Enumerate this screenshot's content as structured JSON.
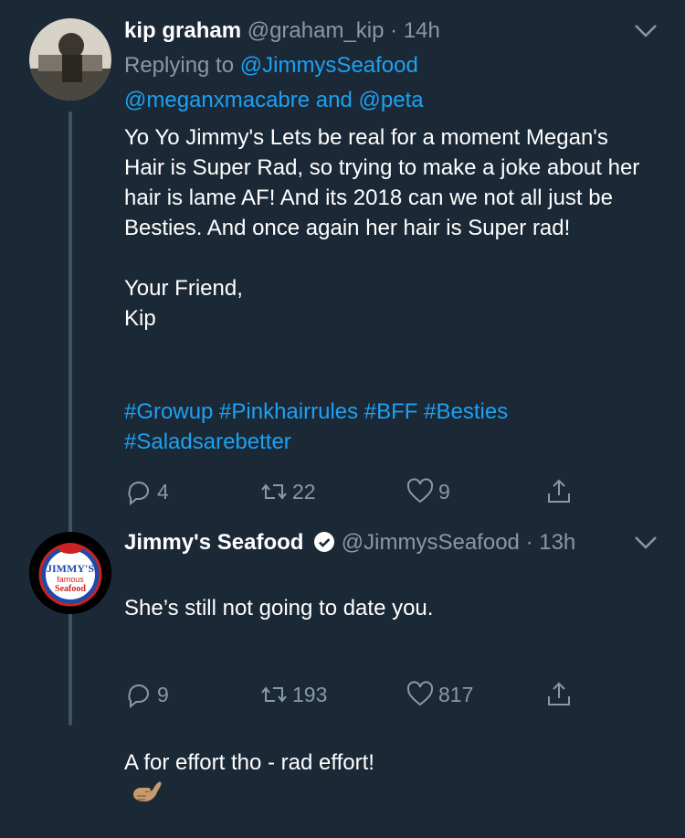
{
  "tweets": [
    {
      "name": "kip graham",
      "handle": "@graham_kip",
      "time": "· 14h",
      "replying_prefix": "Replying to",
      "reply_to_1": "@JimmysSeafood",
      "reply_to_2": "@meganxmacabre",
      "reply_and": "and",
      "reply_to_3": "@peta",
      "text": "Yo Yo Jimmy's Lets be real for a moment Megan's Hair is Super Rad, so trying to make a joke about her hair is lame AF! And its 2018 can we not all just be Besties. And once again her hair is Super rad!\n\nYour Friend,\nKip",
      "hashtags_line1": "#Growup #Pinkhairrules #BFF #Besties",
      "hashtags_line2": "#Saladsarebetter",
      "replies": "4",
      "retweets": "22",
      "likes": "9"
    },
    {
      "name": "Jimmy's Seafood",
      "handle": "@JimmysSeafood",
      "time": "· 13h",
      "text_line1": "She’s still not going to date you.",
      "text_line2": "A for effort tho - rad effort!",
      "replies": "9",
      "retweets": "193",
      "likes": "817",
      "logo_text_1": "JIMMY'S",
      "logo_text_2": "famous",
      "logo_text_3": "Seafood"
    }
  ],
  "colors": {
    "background": "#1b2836",
    "link": "#1da1f2",
    "muted": "#8899a6",
    "verified": "#ffffff"
  },
  "icons": [
    "reply-icon",
    "retweet-icon",
    "like-icon",
    "share-icon",
    "chevron-down-icon",
    "verified-badge-icon",
    "call-me-hand-emoji"
  ]
}
